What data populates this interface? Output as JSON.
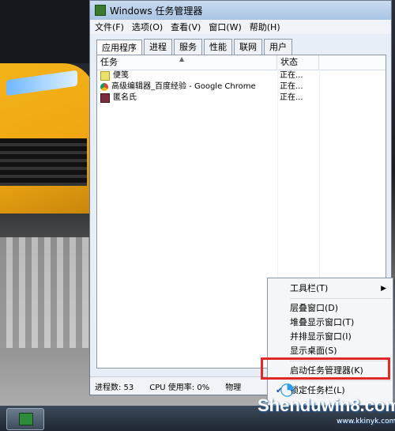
{
  "window": {
    "title": "Windows 任务管理器"
  },
  "menubar": {
    "file": "文件(F)",
    "options": "选项(O)",
    "view": "查看(V)",
    "window": "窗口(W)",
    "help": "帮助(H)"
  },
  "tabs": [
    "应用程序",
    "进程",
    "服务",
    "性能",
    "联网",
    "用户"
  ],
  "table": {
    "col_task": "任务",
    "col_status": "状态",
    "rows": [
      {
        "name": "便笺",
        "status": "正在..."
      },
      {
        "name": "高级编辑器_百度经验 - Google Chrome",
        "status": "正在..."
      },
      {
        "name": "匿名氏",
        "status": "正在..."
      }
    ]
  },
  "statusbar": {
    "processes": "进程数: 53",
    "cpu": "CPU 使用率: 0%",
    "memory": "物理"
  },
  "context_menu": {
    "toolbars": "工具栏(T)",
    "cascade": "层叠窗口(D)",
    "stack": "堆叠显示窗口(T)",
    "side_by_side": "并排显示窗口(I)",
    "show_desktop": "显示桌面(S)",
    "start_task_manager": "启动任务管理器(K)",
    "lock_taskbar": "锁定任务栏(L)"
  },
  "watermark": {
    "text": "Shenduwin8.com",
    "url": "www.kkinyk.com"
  },
  "colors": {
    "highlight_box": "#e02a2a",
    "title_gradient_top": "#c9dbef",
    "title_gradient_bottom": "#a9c4e4"
  }
}
